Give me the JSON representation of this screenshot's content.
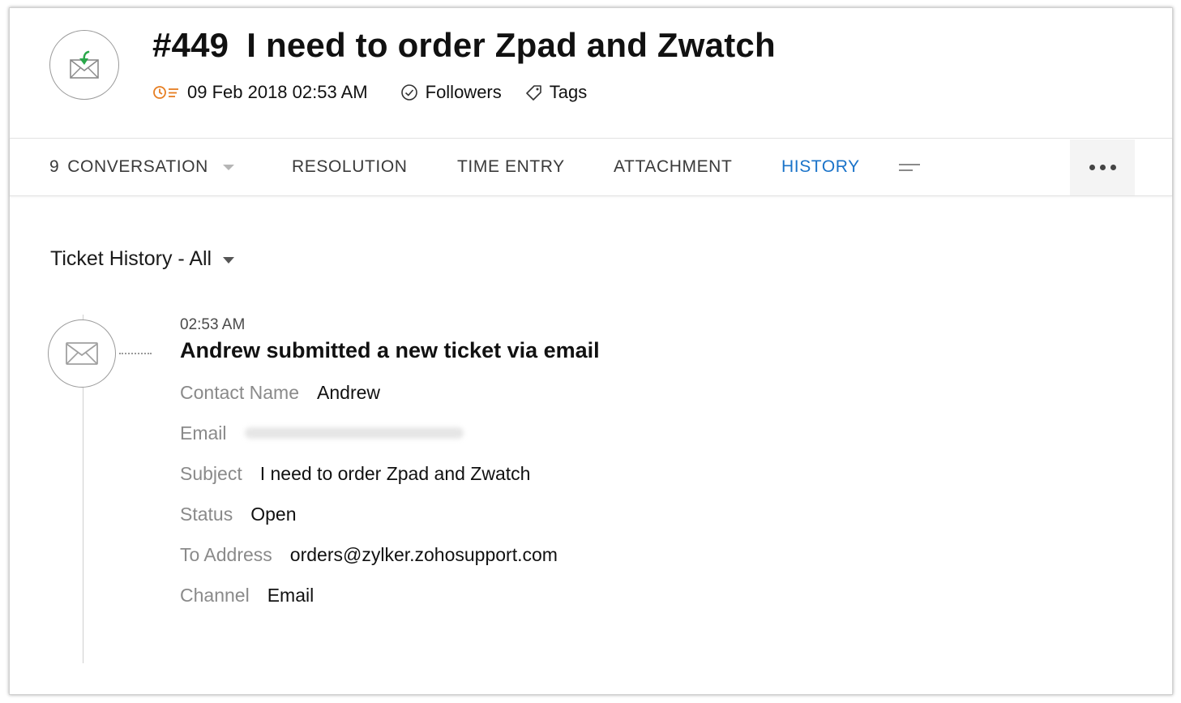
{
  "ticket": {
    "number": "#449",
    "title": "I need to order Zpad and Zwatch",
    "icon": "email-received-icon",
    "date": "09 Feb 2018 02:53 AM",
    "followers_label": "Followers",
    "tags_label": "Tags"
  },
  "tabs": {
    "conversation_count": "9",
    "conversation": "CONVERSATION",
    "resolution": "RESOLUTION",
    "time_entry": "TIME ENTRY",
    "attachment": "ATTACHMENT",
    "history": "HISTORY",
    "active": "HISTORY"
  },
  "history": {
    "filter_label": "Ticket History - All",
    "entries": [
      {
        "time": "02:53 AM",
        "title": "Andrew submitted a new ticket via email",
        "icon": "envelope-icon",
        "fields": [
          {
            "label": "Contact Name",
            "value": "Andrew"
          },
          {
            "label": "Email",
            "value": ""
          },
          {
            "label": "Subject",
            "value": "I need to order Zpad and Zwatch"
          },
          {
            "label": "Status",
            "value": "Open"
          },
          {
            "label": "To Address",
            "value": "orders@zylker.zohosupport.com"
          },
          {
            "label": "Channel",
            "value": "Email"
          }
        ]
      }
    ]
  },
  "colors": {
    "accent": "#1a73c9",
    "date_icon": "#e67e22",
    "mail_arrow": "#2aa84a"
  }
}
